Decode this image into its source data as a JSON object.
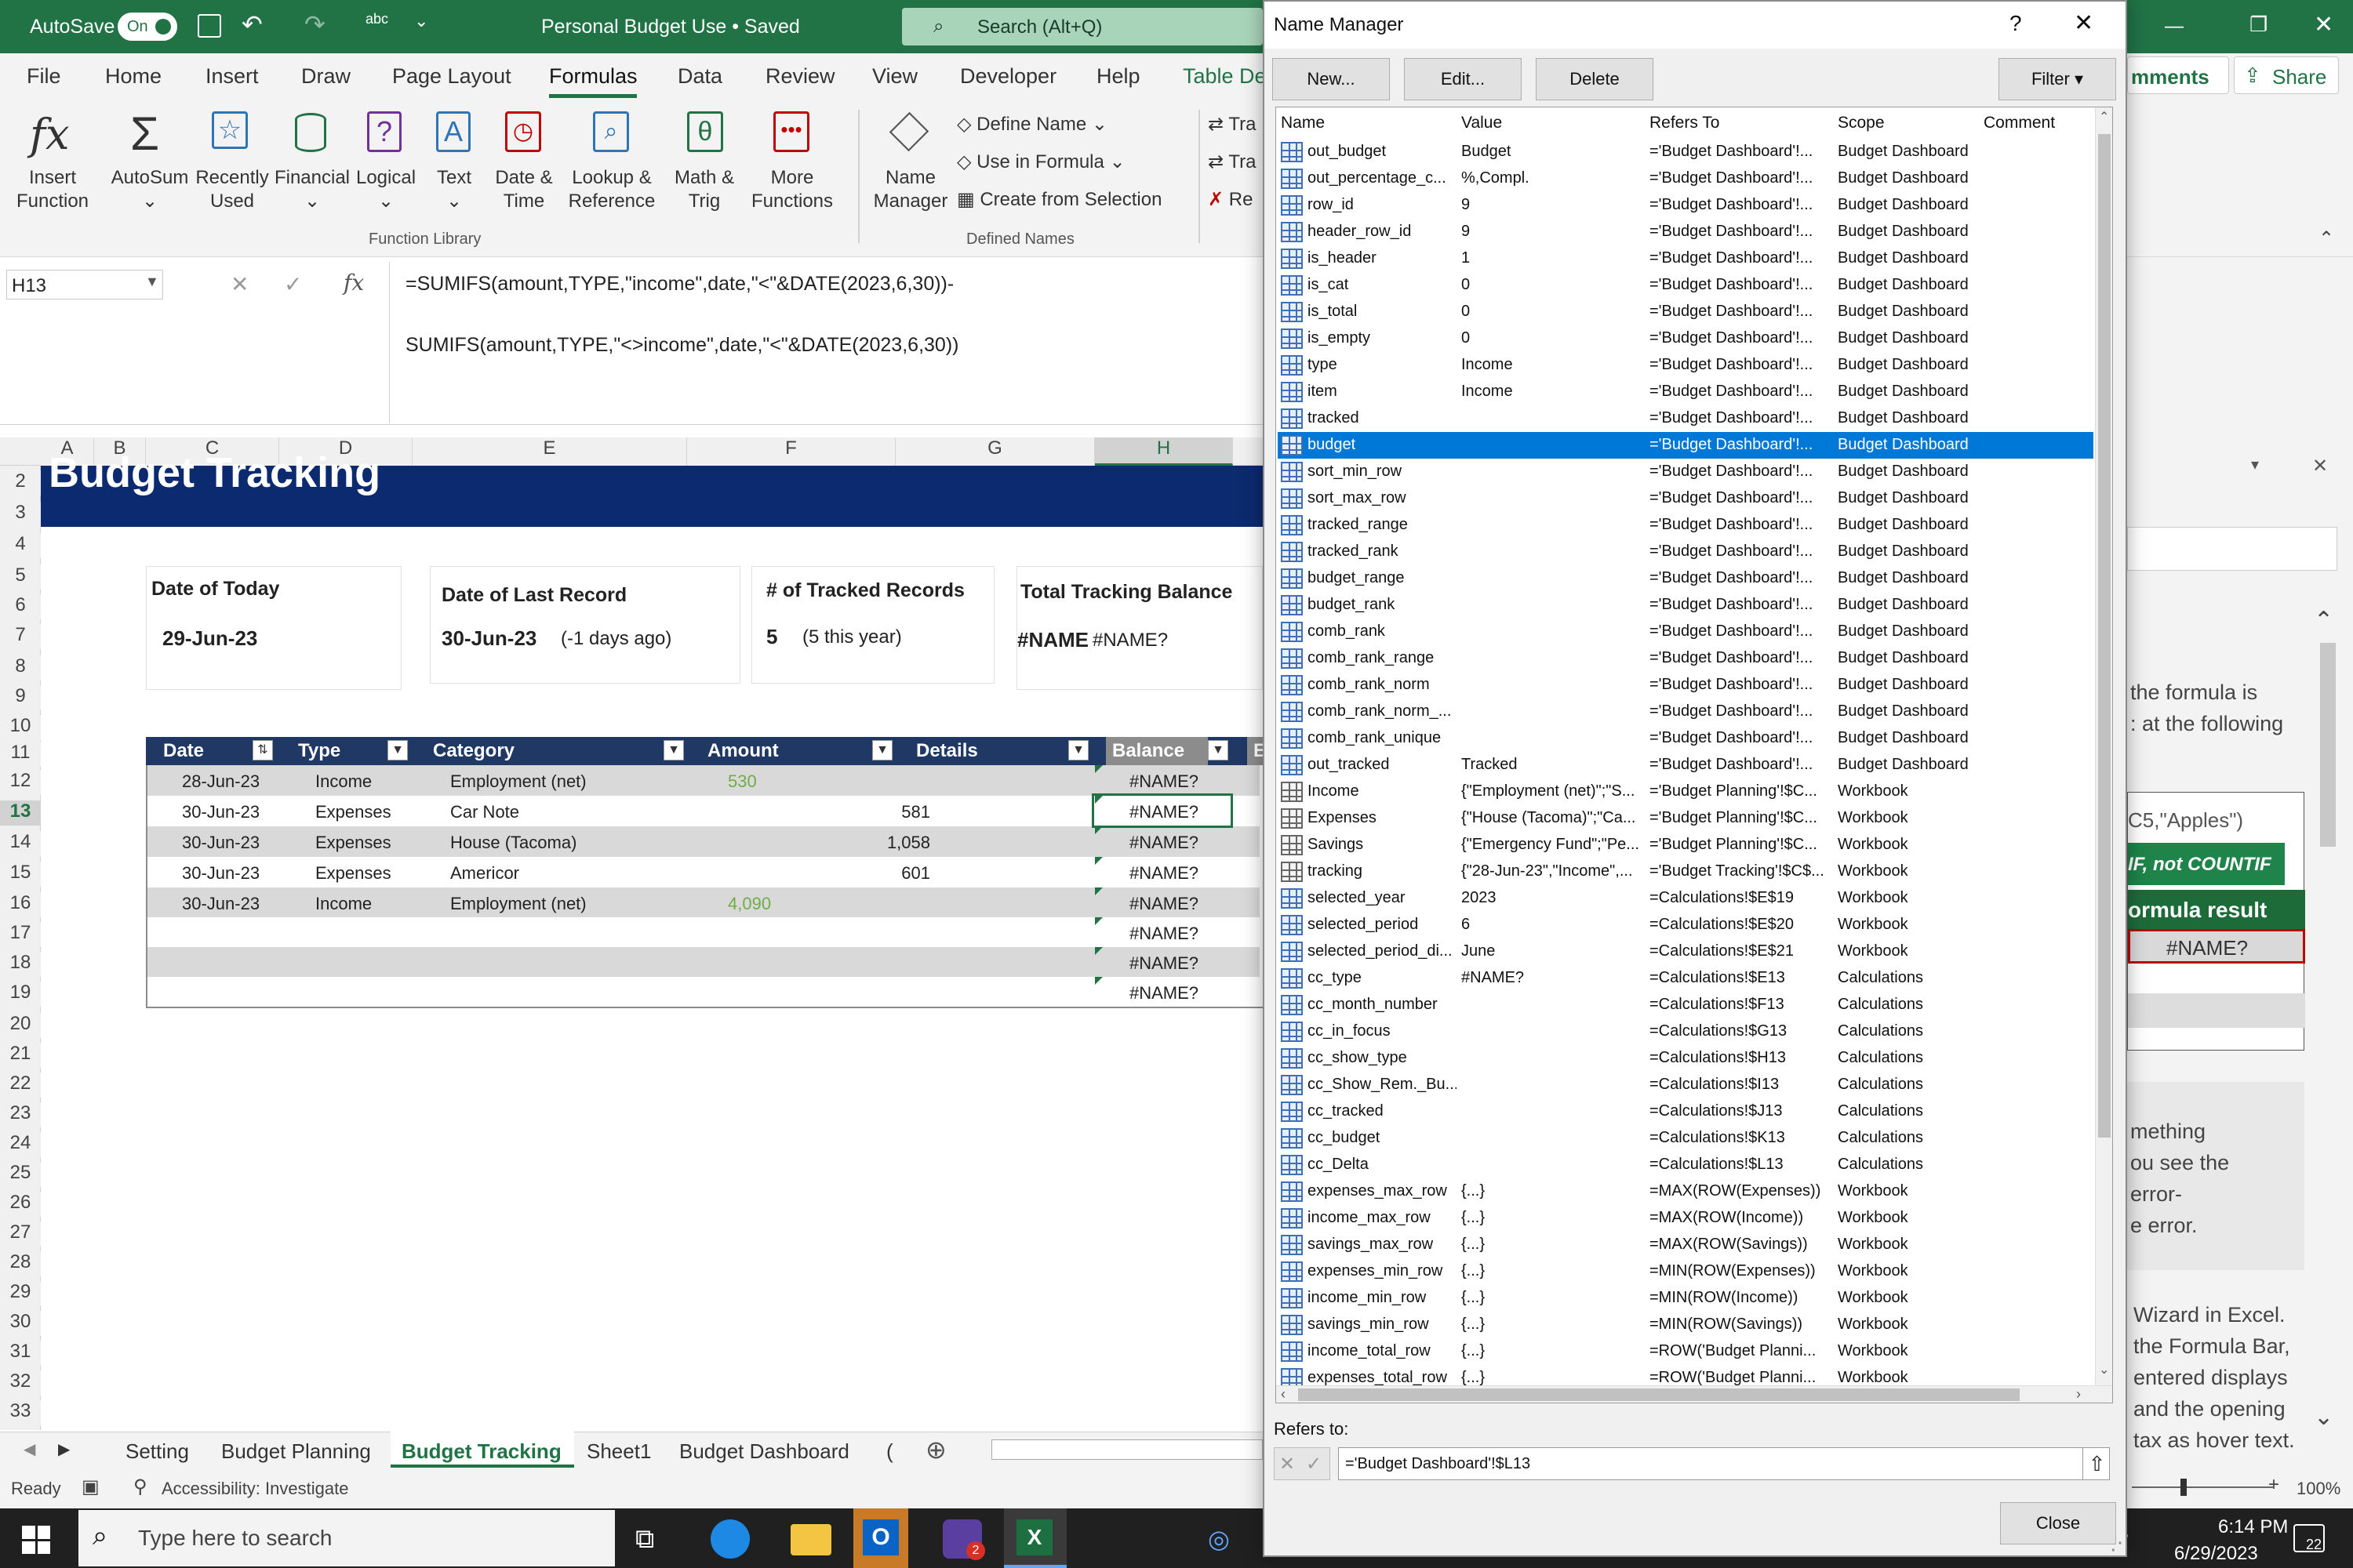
{
  "titlebar": {
    "autosave": "AutoSave",
    "autosave_state": "On",
    "title": "Personal Budget Use • Saved",
    "search": "Search (Alt+Q)"
  },
  "menu": [
    "File",
    "Home",
    "Insert",
    "Draw",
    "Page Layout",
    "Formulas",
    "Data",
    "Review",
    "View",
    "Developer",
    "Help",
    "Table De"
  ],
  "menu_active": "Formulas",
  "comments_label": "mments",
  "share_label": "Share",
  "ribbon": {
    "insert_function": [
      "Insert",
      "Function"
    ],
    "autosum": "AutoSum",
    "recently_used": [
      "Recently",
      "Used"
    ],
    "financial": "Financial",
    "logical": "Logical",
    "text": "Text",
    "date_time": [
      "Date &",
      "Time"
    ],
    "lookup_reference": [
      "Lookup &",
      "Reference"
    ],
    "math_trig": [
      "Math &",
      "Trig"
    ],
    "more_functions": [
      "More",
      "Functions"
    ],
    "group_function_library": "Function Library",
    "name_manager": [
      "Name",
      "Manager"
    ],
    "define_name": "Define Name",
    "use_in_formula": "Use in Formula",
    "create_from_selection": "Create from Selection",
    "group_defined_names": "Defined Names",
    "trace1": "Tra",
    "trace2": "Tra",
    "remove": "Re"
  },
  "formula_bar": {
    "name_box": "H13",
    "fx": "fx",
    "line1": "=SUMIFS(amount,TYPE,\"income\",date,\"<\"&DATE(2023,6,30))-",
    "line2": "SUMIFS(amount,TYPE,\"<>income\",date,\"<\"&DATE(2023,6,30))"
  },
  "columns": [
    "A",
    "B",
    "C",
    "D",
    "E",
    "F",
    "G",
    "H"
  ],
  "rows": [
    "2",
    "3",
    "4",
    "5",
    "6",
    "7",
    "8",
    "9",
    "10",
    "11",
    "12",
    "13",
    "14",
    "15",
    "16",
    "17",
    "18",
    "19",
    "20",
    "21",
    "22",
    "23",
    "24",
    "25",
    "26",
    "27",
    "28",
    "29",
    "30",
    "31",
    "32",
    "33"
  ],
  "sheet": {
    "title": "Budget Tracking",
    "cards": [
      {
        "label": "Date of Today",
        "value": "29-Jun-23",
        "extra": ""
      },
      {
        "label": "Date of Last Record",
        "value": "30-Jun-23",
        "extra": "(-1 days ago)"
      },
      {
        "label": "# of Tracked Records",
        "value": "5",
        "extra": "(5 this year)"
      },
      {
        "label": "Total Tracking Balance",
        "value": "#NAME",
        "extra": "#NAME?"
      }
    ],
    "headers": [
      "Date",
      "Type",
      "Category",
      "Amount",
      "Details",
      "Balance",
      "E"
    ],
    "rows": [
      {
        "date": "28-Jun-23",
        "type": "Income",
        "category": "Employment (net)",
        "income_amt": "530",
        "exp_amt": "",
        "balance": "#NAME?"
      },
      {
        "date": "30-Jun-23",
        "type": "Expenses",
        "category": "Car Note",
        "income_amt": "",
        "exp_amt": "581",
        "balance": "#NAME?"
      },
      {
        "date": "30-Jun-23",
        "type": "Expenses",
        "category": "House (Tacoma)",
        "income_amt": "",
        "exp_amt": "1,058",
        "balance": "#NAME?"
      },
      {
        "date": "30-Jun-23",
        "type": "Expenses",
        "category": "Americor",
        "income_amt": "",
        "exp_amt": "601",
        "balance": "#NAME?"
      },
      {
        "date": "30-Jun-23",
        "type": "Income",
        "category": "Employment (net)",
        "income_amt": "4,090",
        "exp_amt": "",
        "balance": "#NAME?"
      },
      {
        "date": "",
        "type": "",
        "category": "",
        "income_amt": "",
        "exp_amt": "",
        "balance": "#NAME?"
      },
      {
        "date": "",
        "type": "",
        "category": "",
        "income_amt": "",
        "exp_amt": "",
        "balance": "#NAME?"
      },
      {
        "date": "",
        "type": "",
        "category": "",
        "income_amt": "",
        "exp_amt": "",
        "balance": "#NAME?"
      }
    ]
  },
  "sheet_tabs": [
    "Setting",
    "Budget Planning",
    "Budget Tracking",
    "Sheet1",
    "Budget Dashboard",
    "("
  ],
  "active_sheet": "Budget Tracking",
  "status": {
    "ready": "Ready",
    "accessibility": "Accessibility: Investigate",
    "zoom": "100%"
  },
  "side_panel": {
    "lines_a": [
      "the formula is",
      ": at the following"
    ],
    "snippet1": "C5,\"Apples\")",
    "snippet2": "IF, not COUNTIF",
    "snippet3": "ormula result",
    "snippet4": "#NAME?",
    "lines_b": [
      "mething",
      "ou see the",
      "error-",
      "e error."
    ],
    "lines_c": [
      "Wizard in Excel.",
      "the Formula Bar,",
      "entered displays",
      "and the opening",
      "tax as hover text."
    ]
  },
  "name_manager": {
    "title": "Name Manager",
    "help": "?",
    "buttons": {
      "new": "New...",
      "edit": "Edit...",
      "delete": "Delete",
      "filter": "Filter"
    },
    "columns": [
      "Name",
      "Value",
      "Refers To",
      "Scope",
      "Comment"
    ],
    "items": [
      {
        "name": "out_budget",
        "value": "Budget",
        "refers": "='Budget Dashboard'!...",
        "scope": "Budget Dashboard",
        "kind": "name"
      },
      {
        "name": "out_percentage_c...",
        "value": "%,Compl.",
        "refers": "='Budget Dashboard'!...",
        "scope": "Budget Dashboard",
        "kind": "name"
      },
      {
        "name": "row_id",
        "value": "9",
        "refers": "='Budget Dashboard'!...",
        "scope": "Budget Dashboard",
        "kind": "name"
      },
      {
        "name": "header_row_id",
        "value": "9",
        "refers": "='Budget Dashboard'!...",
        "scope": "Budget Dashboard",
        "kind": "name"
      },
      {
        "name": "is_header",
        "value": "1",
        "refers": "='Budget Dashboard'!...",
        "scope": "Budget Dashboard",
        "kind": "name"
      },
      {
        "name": "is_cat",
        "value": "0",
        "refers": "='Budget Dashboard'!...",
        "scope": "Budget Dashboard",
        "kind": "name"
      },
      {
        "name": "is_total",
        "value": "0",
        "refers": "='Budget Dashboard'!...",
        "scope": "Budget Dashboard",
        "kind": "name"
      },
      {
        "name": "is_empty",
        "value": "0",
        "refers": "='Budget Dashboard'!...",
        "scope": "Budget Dashboard",
        "kind": "name"
      },
      {
        "name": "type",
        "value": "Income",
        "refers": "='Budget Dashboard'!...",
        "scope": "Budget Dashboard",
        "kind": "name"
      },
      {
        "name": "item",
        "value": "Income",
        "refers": "='Budget Dashboard'!...",
        "scope": "Budget Dashboard",
        "kind": "name"
      },
      {
        "name": "tracked",
        "value": "",
        "refers": "='Budget Dashboard'!...",
        "scope": "Budget Dashboard",
        "kind": "name"
      },
      {
        "name": "budget",
        "value": "",
        "refers": "='Budget Dashboard'!...",
        "scope": "Budget Dashboard",
        "kind": "name",
        "selected": true
      },
      {
        "name": "sort_min_row",
        "value": "",
        "refers": "='Budget Dashboard'!...",
        "scope": "Budget Dashboard",
        "kind": "name"
      },
      {
        "name": "sort_max_row",
        "value": "",
        "refers": "='Budget Dashboard'!...",
        "scope": "Budget Dashboard",
        "kind": "name"
      },
      {
        "name": "tracked_range",
        "value": "",
        "refers": "='Budget Dashboard'!...",
        "scope": "Budget Dashboard",
        "kind": "name"
      },
      {
        "name": "tracked_rank",
        "value": "",
        "refers": "='Budget Dashboard'!...",
        "scope": "Budget Dashboard",
        "kind": "name"
      },
      {
        "name": "budget_range",
        "value": "",
        "refers": "='Budget Dashboard'!...",
        "scope": "Budget Dashboard",
        "kind": "name"
      },
      {
        "name": "budget_rank",
        "value": "",
        "refers": "='Budget Dashboard'!...",
        "scope": "Budget Dashboard",
        "kind": "name"
      },
      {
        "name": "comb_rank",
        "value": "",
        "refers": "='Budget Dashboard'!...",
        "scope": "Budget Dashboard",
        "kind": "name"
      },
      {
        "name": "comb_rank_range",
        "value": "",
        "refers": "='Budget Dashboard'!...",
        "scope": "Budget Dashboard",
        "kind": "name"
      },
      {
        "name": "comb_rank_norm",
        "value": "",
        "refers": "='Budget Dashboard'!...",
        "scope": "Budget Dashboard",
        "kind": "name"
      },
      {
        "name": "comb_rank_norm_...",
        "value": "",
        "refers": "='Budget Dashboard'!...",
        "scope": "Budget Dashboard",
        "kind": "name"
      },
      {
        "name": "comb_rank_unique",
        "value": "",
        "refers": "='Budget Dashboard'!...",
        "scope": "Budget Dashboard",
        "kind": "name"
      },
      {
        "name": "out_tracked",
        "value": "Tracked",
        "refers": "='Budget Dashboard'!...",
        "scope": "Budget Dashboard",
        "kind": "name"
      },
      {
        "name": "Income",
        "value": "{\"Employment (net)\";\"S...",
        "refers": "='Budget Planning'!$C...",
        "scope": "Workbook",
        "kind": "table"
      },
      {
        "name": "Expenses",
        "value": "{\"House (Tacoma)\";\"Ca...",
        "refers": "='Budget Planning'!$C...",
        "scope": "Workbook",
        "kind": "table"
      },
      {
        "name": "Savings",
        "value": "{\"Emergency Fund\";\"Pe...",
        "refers": "='Budget Planning'!$C...",
        "scope": "Workbook",
        "kind": "table"
      },
      {
        "name": "tracking",
        "value": "{\"28-Jun-23\",\"Income\",...",
        "refers": "='Budget Tracking'!$C$...",
        "scope": "Workbook",
        "kind": "table"
      },
      {
        "name": "selected_year",
        "value": "2023",
        "refers": "=Calculations!$E$19",
        "scope": "Workbook",
        "kind": "name"
      },
      {
        "name": "selected_period",
        "value": "6",
        "refers": "=Calculations!$E$20",
        "scope": "Workbook",
        "kind": "name"
      },
      {
        "name": "selected_period_di...",
        "value": "June",
        "refers": "=Calculations!$E$21",
        "scope": "Workbook",
        "kind": "name"
      },
      {
        "name": "cc_type",
        "value": "#NAME?",
        "refers": "=Calculations!$E13",
        "scope": "Calculations",
        "kind": "name"
      },
      {
        "name": "cc_month_number",
        "value": "",
        "refers": "=Calculations!$F13",
        "scope": "Calculations",
        "kind": "name"
      },
      {
        "name": "cc_in_focus",
        "value": "",
        "refers": "=Calculations!$G13",
        "scope": "Calculations",
        "kind": "name"
      },
      {
        "name": "cc_show_type",
        "value": "",
        "refers": "=Calculations!$H13",
        "scope": "Calculations",
        "kind": "name"
      },
      {
        "name": "cc_Show_Rem._Bu...",
        "value": "",
        "refers": "=Calculations!$I13",
        "scope": "Calculations",
        "kind": "name"
      },
      {
        "name": "cc_tracked",
        "value": "",
        "refers": "=Calculations!$J13",
        "scope": "Calculations",
        "kind": "name"
      },
      {
        "name": "cc_budget",
        "value": "",
        "refers": "=Calculations!$K13",
        "scope": "Calculations",
        "kind": "name"
      },
      {
        "name": "cc_Delta",
        "value": "",
        "refers": "=Calculations!$L13",
        "scope": "Calculations",
        "kind": "name"
      },
      {
        "name": "expenses_max_row",
        "value": "{...}",
        "refers": "=MAX(ROW(Expenses))",
        "scope": "Workbook",
        "kind": "name"
      },
      {
        "name": "income_max_row",
        "value": "{...}",
        "refers": "=MAX(ROW(Income))",
        "scope": "Workbook",
        "kind": "name"
      },
      {
        "name": "savings_max_row",
        "value": "{...}",
        "refers": "=MAX(ROW(Savings))",
        "scope": "Workbook",
        "kind": "name"
      },
      {
        "name": "expenses_min_row",
        "value": "{...}",
        "refers": "=MIN(ROW(Expenses))",
        "scope": "Workbook",
        "kind": "name"
      },
      {
        "name": "income_min_row",
        "value": "{...}",
        "refers": "=MIN(ROW(Income))",
        "scope": "Workbook",
        "kind": "name"
      },
      {
        "name": "savings_min_row",
        "value": "{...}",
        "refers": "=MIN(ROW(Savings))",
        "scope": "Workbook",
        "kind": "name"
      },
      {
        "name": "income_total_row",
        "value": "{...}",
        "refers": "=ROW('Budget Planni...",
        "scope": "Workbook",
        "kind": "name"
      },
      {
        "name": "expenses_total_row",
        "value": "{...}",
        "refers": "=ROW('Budget Planni...",
        "scope": "Workbook",
        "kind": "name"
      }
    ],
    "refers_to_label": "Refers to:",
    "refers_to_value": "='Budget Dashboard'!$L13",
    "close": "Close"
  },
  "taskbar": {
    "search": "Type here to search",
    "time": "6:14 PM",
    "date": "6/29/2023",
    "outlook_badge": "2",
    "notif": "22"
  },
  "colors": {
    "excel_green": "#217346",
    "header_navy": "#1f3864",
    "selection_blue": "#0078d7",
    "income_green": "#70ad47"
  }
}
